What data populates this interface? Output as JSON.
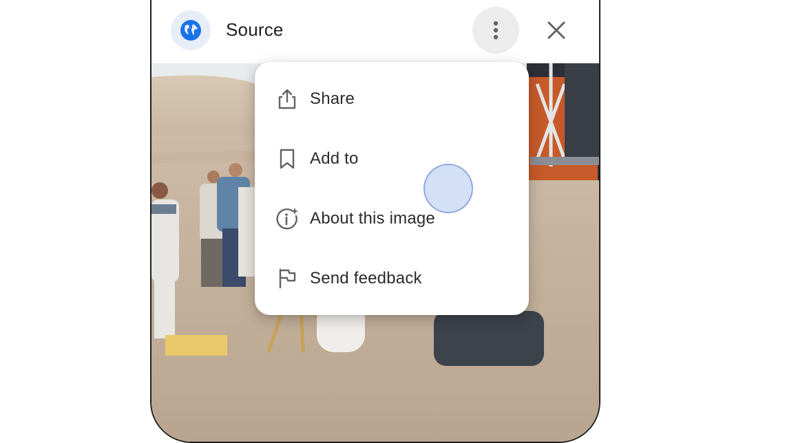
{
  "header": {
    "title": "Source",
    "globe_icon": "globe-icon",
    "more_icon": "more-vert-icon",
    "close_icon": "close-icon"
  },
  "menu": {
    "items": [
      {
        "label": "Share",
        "icon": "share-icon"
      },
      {
        "label": "Add to",
        "icon": "bookmark-icon"
      },
      {
        "label": "About this image",
        "icon": "info-sparkle-icon"
      },
      {
        "label": "Send feedback",
        "icon": "flag-icon"
      }
    ]
  },
  "colors": {
    "accent_blue": "#1a73e8",
    "globe_bg": "#e8eef8",
    "more_btn_bg": "#ececec",
    "touch_indicator": "#cddaf5"
  }
}
